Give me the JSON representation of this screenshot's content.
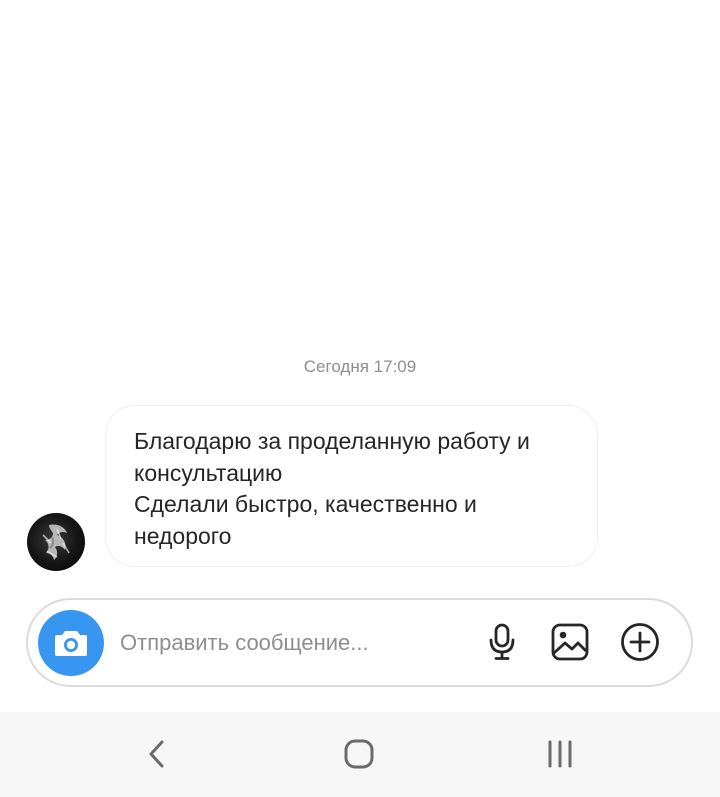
{
  "thread": {
    "timestamp": "Сегодня 17:09",
    "message": {
      "text": "Благодарю за проделанную работу и\nконсультацию\nСделали быстро, качественно и\nнедорого"
    }
  },
  "composer": {
    "placeholder": "Отправить сообщение..."
  },
  "icons": {
    "camera": "camera-icon",
    "microphone": "microphone-icon",
    "gallery": "gallery-icon",
    "add": "plus-circle-icon",
    "back": "back-icon",
    "home": "home-icon",
    "recents": "recents-icon"
  },
  "colors": {
    "accent": "#3797f0",
    "text": "#262626",
    "secondary": "#8e8e8e",
    "border": "#dbdbdb",
    "nav_bar": "#f6f6f6"
  }
}
